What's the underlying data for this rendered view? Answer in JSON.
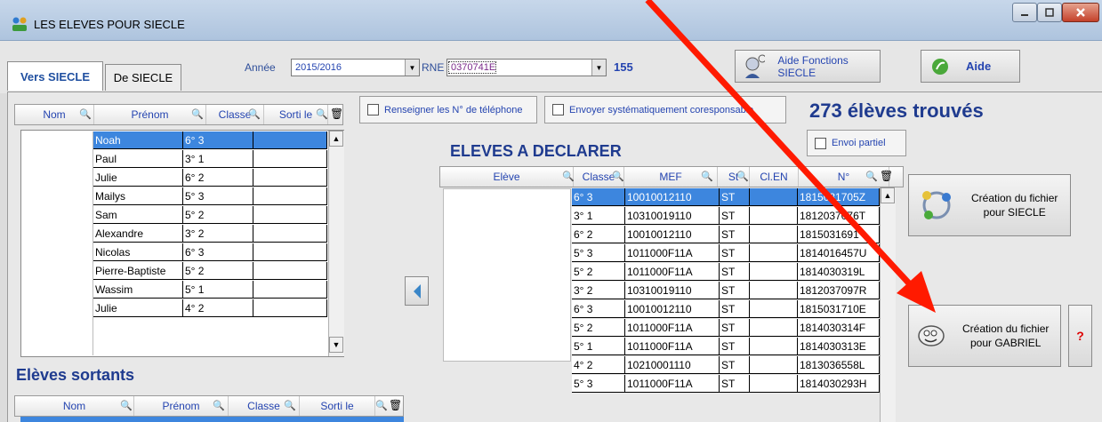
{
  "window": {
    "title": "LES ELEVES POUR SIECLE"
  },
  "tabs": [
    {
      "label": "Vers SIECLE",
      "active": true
    },
    {
      "label": "De SIECLE",
      "active": false
    }
  ],
  "filters": {
    "annee_label": "Année",
    "annee_value": "2015/2016",
    "rne_label": "RNE",
    "rne_value": "0370741E",
    "rne_count": "155"
  },
  "buttons": {
    "aide_fonctions": "Aide Fonctions SIECLE",
    "aide": "Aide",
    "creation_siecle_line1": "Création du fichier",
    "creation_siecle_line2": "pour SIECLE",
    "creation_gabriel_line1": "Création du fichier",
    "creation_gabriel_line2": "pour GABRIEL",
    "question": "?"
  },
  "options": {
    "telephone": "Renseigner les N° de téléphone",
    "envoyer": "Envoyer systématiquement  coresponsable",
    "envoi_partiel": "Envoi partiel"
  },
  "found_label": "273 élèves trouvés",
  "eleves_title": "ELEVES A DECLARER",
  "sortants_title": "Elèves sortants",
  "left_grid": {
    "headers": [
      "Nom",
      "Prénom",
      "Classe",
      "Sorti le"
    ],
    "rows": [
      {
        "prenom": "Noah",
        "classe": "6° 3"
      },
      {
        "prenom": "Paul",
        "classe": "3° 1"
      },
      {
        "prenom": "Julie",
        "classe": "6° 2"
      },
      {
        "prenom": "Mailys",
        "classe": "5° 3"
      },
      {
        "prenom": "Sam",
        "classe": "5° 2"
      },
      {
        "prenom": "Alexandre",
        "classe": "3° 2"
      },
      {
        "prenom": "Nicolas",
        "classe": "6° 3"
      },
      {
        "prenom": "Pierre-Baptiste",
        "classe": "5° 2"
      },
      {
        "prenom": "Wassim",
        "classe": "5° 1"
      },
      {
        "prenom": "Julie",
        "classe": "4° 2"
      }
    ]
  },
  "right_grid": {
    "headers": [
      "Elève",
      "Classe",
      "MEF",
      "St",
      "Cl.EN",
      "N°"
    ],
    "rows": [
      {
        "classe": "6° 3",
        "mef": "10010012110",
        "st": "ST",
        "num": "1815031705Z"
      },
      {
        "classe": "3° 1",
        "mef": "10310019110",
        "st": "ST",
        "num": "1812037076T"
      },
      {
        "classe": "6° 2",
        "mef": "10010012110",
        "st": "ST",
        "num": "1815031691"
      },
      {
        "classe": "5° 3",
        "mef": "1011000F11A",
        "st": "ST",
        "num": "1814016457U"
      },
      {
        "classe": "5° 2",
        "mef": "1011000F11A",
        "st": "ST",
        "num": "1814030319L"
      },
      {
        "classe": "3° 2",
        "mef": "10310019110",
        "st": "ST",
        "num": "1812037097R"
      },
      {
        "classe": "6° 3",
        "mef": "10010012110",
        "st": "ST",
        "num": "1815031710E"
      },
      {
        "classe": "5° 2",
        "mef": "1011000F11A",
        "st": "ST",
        "num": "1814030314F"
      },
      {
        "classe": "5° 1",
        "mef": "1011000F11A",
        "st": "ST",
        "num": "1814030313E"
      },
      {
        "classe": "4° 2",
        "mef": "10210001110",
        "st": "ST",
        "num": "1813036558L"
      },
      {
        "classe": "5° 3",
        "mef": "1011000F11A",
        "st": "ST",
        "num": "1814030293H"
      }
    ]
  },
  "sortants_grid": {
    "headers": [
      "Nom",
      "Prénom",
      "Classe",
      "Sorti le"
    ]
  },
  "colors": {
    "title_blue": "#1f3b8f",
    "header_blue": "#2444b0",
    "selection": "#3d86de",
    "annotation_arrow": "#ff1a00"
  }
}
